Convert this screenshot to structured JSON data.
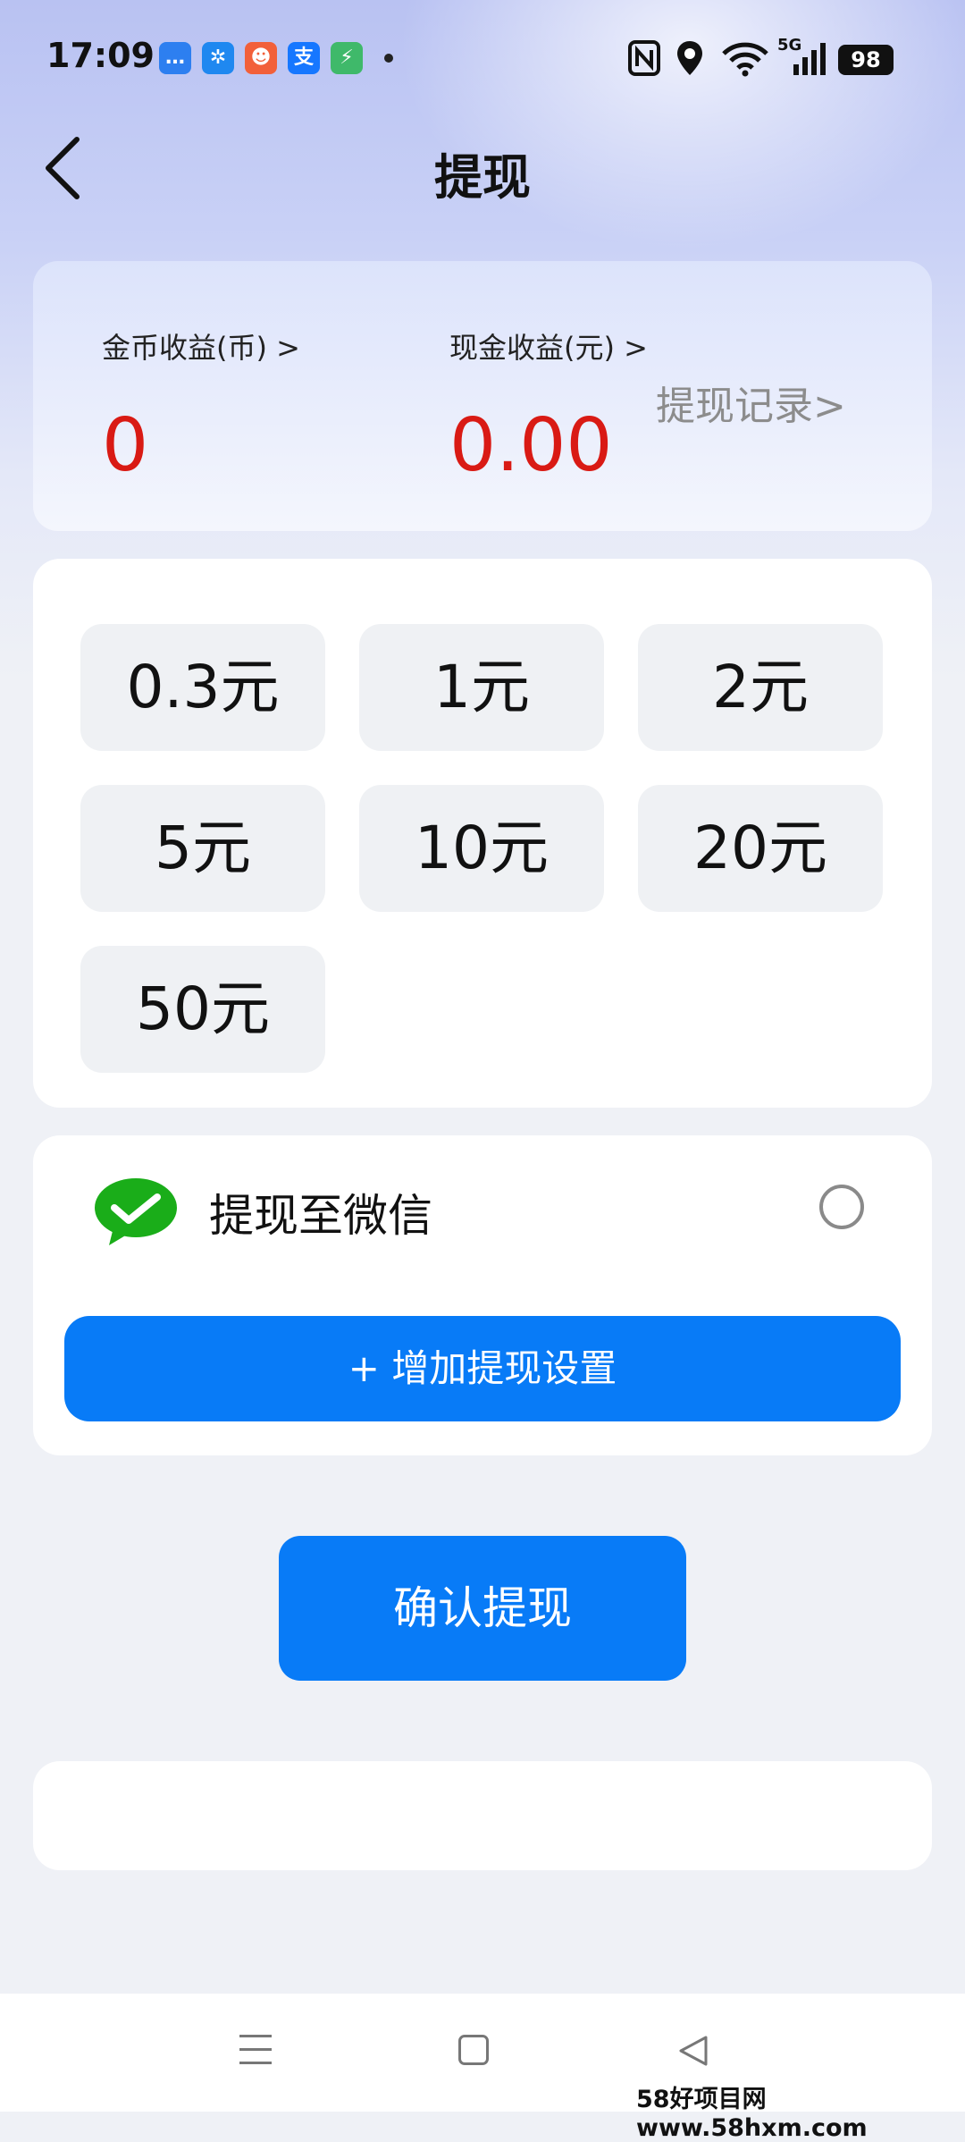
{
  "status_bar": {
    "time": "17:09",
    "notification_icons": [
      {
        "name": "message-icon",
        "glyph": "…",
        "color": "#2d7ff0"
      },
      {
        "name": "pinwheel-app-icon",
        "glyph": "✲",
        "color": "#1f88f0"
      },
      {
        "name": "video-app-icon",
        "glyph": "☻",
        "color": "#f2603a"
      },
      {
        "name": "alipay-icon",
        "glyph": "支",
        "color": "#1677ff"
      },
      {
        "name": "security-shield-icon",
        "glyph": "⚡",
        "color": "#3fb96a"
      }
    ],
    "network": "5G",
    "battery": "98"
  },
  "header": {
    "title": "提现"
  },
  "earnings": {
    "coin_label": "金币收益(币) >",
    "coin_value": "0",
    "cash_label": "现金收益(元) >",
    "cash_value": "0.00",
    "record_link": "提现记录>"
  },
  "amounts": [
    "0.3元",
    "1元",
    "2元",
    "5元",
    "10元",
    "20元",
    "50元"
  ],
  "payout": {
    "wechat_label": "提现至微信",
    "add_button": "+ 增加提现设置"
  },
  "confirm_button": "确认提现",
  "watermark": "58好项目网www.58hxm.com",
  "colors": {
    "accent": "#087bf7",
    "value_red": "#d91a14",
    "wechat_green": "#1aad19"
  }
}
